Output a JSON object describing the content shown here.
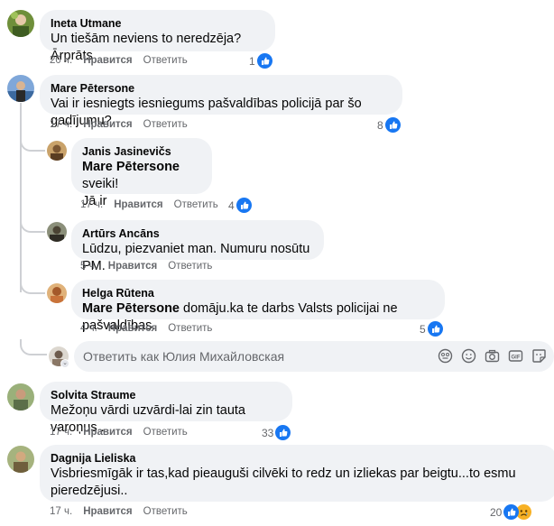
{
  "comments": [
    {
      "author": "Ineta Utmane",
      "text": "Un tiešām neviens to neredzēja? Ārprāts",
      "time": "20 ч.",
      "like_label": "Нравится",
      "reply_label": "Ответить",
      "reaction_count": "1"
    },
    {
      "author": "Mare Pētersone",
      "text": "Vai ir iesniegts iesniegums pašvaldības policijā par šo gadījumu?",
      "time": "17 ч.",
      "like_label": "Нравится",
      "reply_label": "Ответить",
      "reaction_count": "8"
    }
  ],
  "replies": [
    {
      "author": "Janis Jasinevičs",
      "mention": "Mare Pētersone",
      "text_after_mention": " sveiki!",
      "text_line2": "Jā ir",
      "time": "17 ч.",
      "like_label": "Нравится",
      "reply_label": "Ответить",
      "reaction_count": "4"
    },
    {
      "author": "Artūrs Ancāns",
      "text": "Lūdzu, piezvaniet man. Numuru nosūtu PM.",
      "time": "5 ч.",
      "like_label": "Нравится",
      "reply_label": "Ответить"
    },
    {
      "author": "Helga Rūtena",
      "mention": "Mare Pētersone",
      "text_after_mention": " domāju.ka te darbs Valsts policijai ne pašvaldības.",
      "time": "4 ч.",
      "like_label": "Нравится",
      "reply_label": "Ответить",
      "reaction_count": "5"
    }
  ],
  "composer": {
    "placeholder": "Ответить как Юлия Михайловская",
    "icons": [
      "sticker-face-icon",
      "emoji-icon",
      "camera-icon",
      "gif-icon",
      "sticker-icon"
    ]
  },
  "more_comments": [
    {
      "author": "Solvita Straume",
      "text": "Mežoņu vārdi uzvārdi-lai zin tauta varoņus .",
      "time": "17 ч.",
      "like_label": "Нравится",
      "reply_label": "Ответить",
      "reaction_count": "33"
    },
    {
      "author": "Dagnija Lieliska",
      "text_line1": "Visbriesmīgāk ir tas,kad pieauguši cilvēki to redz un izliekas par beigtu...to esmu",
      "text_line2": "pieredzējusi..",
      "time": "17 ч.",
      "like_label": "Нравится",
      "reply_label": "Ответить",
      "reaction_count": "20"
    }
  ],
  "colors": {
    "like_blue": "#1877f2",
    "bubble_bg": "#f0f2f5",
    "meta_text": "#65676b",
    "sad_yellow": "#f7b125"
  }
}
